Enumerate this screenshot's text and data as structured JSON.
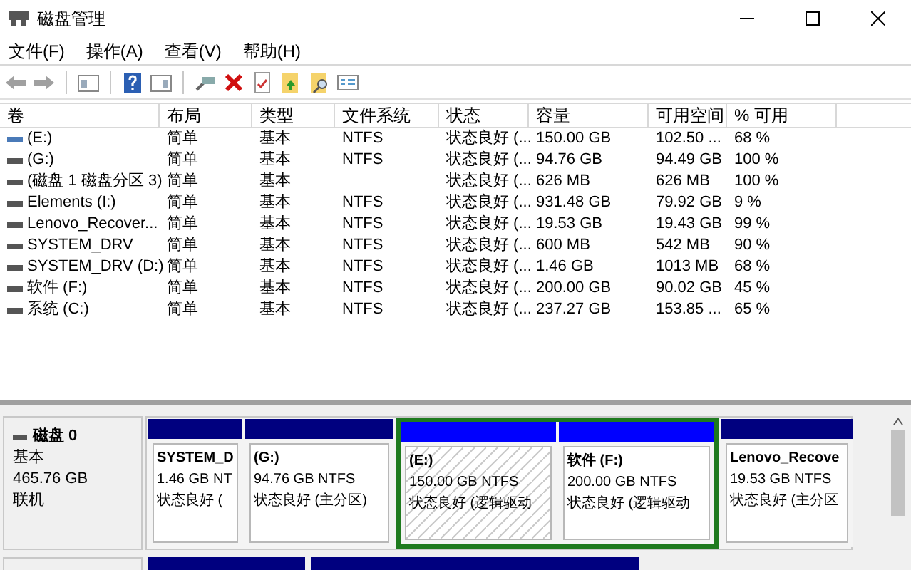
{
  "window": {
    "title": "磁盘管理"
  },
  "menu": [
    "文件(F)",
    "操作(A)",
    "查看(V)",
    "帮助(H)"
  ],
  "table": {
    "columns": [
      "卷",
      "布局",
      "类型",
      "文件系统",
      "状态",
      "容量",
      "可用空间",
      "% 可用"
    ],
    "rows": [
      [
        "(E:)",
        "简单",
        "基本",
        "NTFS",
        "状态良好 (...",
        "150.00 GB",
        "102.50 ...",
        "68 %"
      ],
      [
        "(G:)",
        "简单",
        "基本",
        "NTFS",
        "状态良好 (...",
        "94.76 GB",
        "94.49 GB",
        "100 %"
      ],
      [
        "(磁盘 1 磁盘分区 3)",
        "简单",
        "基本",
        "",
        "状态良好 (...",
        "626 MB",
        "626 MB",
        "100 %"
      ],
      [
        "Elements (I:)",
        "简单",
        "基本",
        "NTFS",
        "状态良好 (...",
        "931.48 GB",
        "79.92 GB",
        "9 %"
      ],
      [
        "Lenovo_Recover...",
        "简单",
        "基本",
        "NTFS",
        "状态良好 (...",
        "19.53 GB",
        "19.43 GB",
        "99 %"
      ],
      [
        "SYSTEM_DRV",
        "简单",
        "基本",
        "NTFS",
        "状态良好 (...",
        "600 MB",
        "542 MB",
        "90 %"
      ],
      [
        "SYSTEM_DRV (D:)",
        "简单",
        "基本",
        "NTFS",
        "状态良好 (...",
        "1.46 GB",
        "1013 MB",
        "68 %"
      ],
      [
        "软件 (F:)",
        "简单",
        "基本",
        "NTFS",
        "状态良好 (...",
        "200.00 GB",
        "90.02 GB",
        "45 %"
      ],
      [
        "系统 (C:)",
        "简单",
        "基本",
        "NTFS",
        "状态良好 (...",
        "237.27 GB",
        "153.85 ...",
        "65 %"
      ]
    ]
  },
  "disk": {
    "name": "磁盘 0",
    "type": "基本",
    "size": "465.76 GB",
    "status": "联机",
    "partitions": [
      {
        "kind": "primary",
        "name": "SYSTEM_D",
        "size": "1.46 GB NT",
        "status": "状态良好 (",
        "selected": false
      },
      {
        "kind": "primary",
        "name": "(G:)",
        "size": "94.76 GB NTFS",
        "status": "状态良好 (主分区)",
        "selected": false
      },
      {
        "kind": "extended",
        "children": [
          {
            "kind": "logical",
            "name": "(E:)",
            "size": "150.00 GB NTFS",
            "status": "状态良好 (逻辑驱动",
            "selected": true
          },
          {
            "kind": "logical",
            "name": "软件  (F:)",
            "size": "200.00 GB NTFS",
            "status": "状态良好 (逻辑驱动",
            "selected": false
          }
        ]
      },
      {
        "kind": "primary",
        "name": "Lenovo_Recove",
        "size": "19.53 GB NTFS",
        "status": "状态良好 (主分区",
        "selected": false
      }
    ]
  }
}
